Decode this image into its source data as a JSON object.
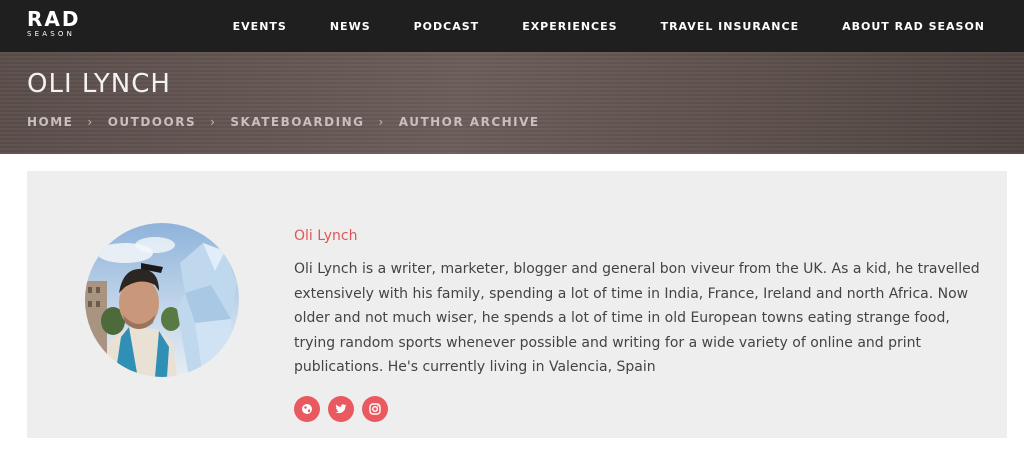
{
  "brand": {
    "logo_main": "RAD",
    "logo_sub": "SEASON"
  },
  "nav": {
    "items": [
      "EVENTS",
      "NEWS",
      "PODCAST",
      "EXPERIENCES",
      "TRAVEL INSURANCE",
      "ABOUT RAD SEASON"
    ]
  },
  "header": {
    "title": "OLI LYNCH",
    "breadcrumb": [
      "HOME",
      "OUTDOORS",
      "SKATEBOARDING",
      "AUTHOR ARCHIVE"
    ],
    "separator": "›"
  },
  "author": {
    "name": "Oli Lynch",
    "bio": "Oli Lynch is a writer, marketer, blogger and general bon viveur from the UK. As a kid, he travelled extensively with his family, spending a lot of time in India, France, Ireland and north Africa. Now older and not much wiser, he spends a lot of time in old European towns eating strange food, trying random sports whenever possible and writing for a wide variety of online and print publications. He's currently living in Valencia, Spain",
    "socials": [
      "globe-icon",
      "twitter-icon",
      "instagram-icon"
    ]
  },
  "colors": {
    "nav_bg": "#1f1f1f",
    "accent": "#e85a5f",
    "name_color": "#e25555",
    "card_bg": "#eeeeee"
  }
}
